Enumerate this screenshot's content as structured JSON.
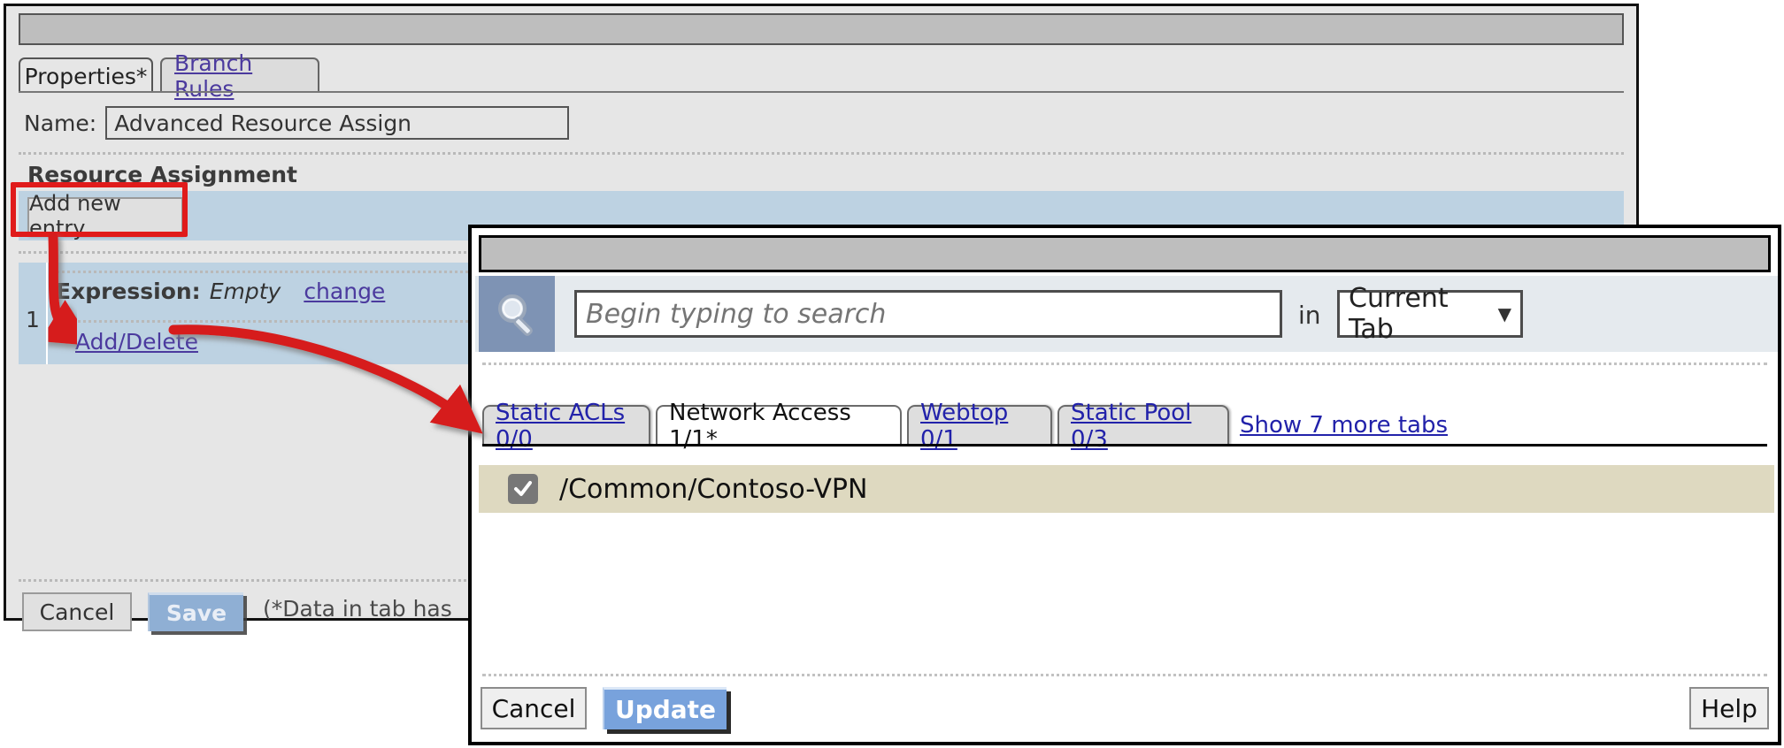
{
  "background_window": {
    "titlebar": "",
    "tabs": [
      {
        "label": "Properties*",
        "active": true
      },
      {
        "label": "Branch Rules",
        "active": false
      }
    ],
    "name_field": {
      "label": "Name:",
      "value": "Advanced Resource Assign",
      "placeholder": ""
    },
    "section_title": "Resource Assignment",
    "add_new_entry_label": "Add new entry",
    "row": {
      "number": "1",
      "expression_label": "Expression:",
      "expression_value": "Empty",
      "change_link": "change",
      "add_delete_link": "Add/Delete"
    },
    "footer": {
      "cancel_label": "Cancel",
      "save_label": "Save",
      "note": "(*Data in tab has"
    }
  },
  "dialog": {
    "titlebar": "",
    "search": {
      "icon": "search-icon",
      "value": "",
      "placeholder": "Begin typing to search",
      "in_label": "in",
      "scope_value": "Current Tab",
      "caret": "chevron-down-icon"
    },
    "tabs": [
      {
        "label": "Static ACLs 0/0",
        "active": false
      },
      {
        "label": "Network Access 1/1*",
        "active": true
      },
      {
        "label": "Webtop 0/1",
        "active": false
      },
      {
        "label": "Static Pool 0/3",
        "active": false
      }
    ],
    "show_more_tabs": "Show 7 more tabs",
    "items": [
      {
        "label": "/Common/Contoso-VPN",
        "checked": true
      }
    ],
    "footer": {
      "cancel_label": "Cancel",
      "update_label": "Update",
      "help_label": "Help"
    }
  },
  "annotations": {
    "highlight_color": "#e01b1b",
    "arrow_color": "#d61f1f",
    "arrow_1_target": "Add/Delete",
    "arrow_2_target": "/Common/Contoso-VPN checkbox"
  },
  "colors": {
    "window_bg": "#e6e6e6",
    "titlebar": "#bebebe",
    "row_band": "#bdd2e2",
    "item_row": "#ded9c0",
    "link": "#4b3a9e",
    "dialog_link": "#2222aa",
    "primary_button": "#78a2dc"
  }
}
